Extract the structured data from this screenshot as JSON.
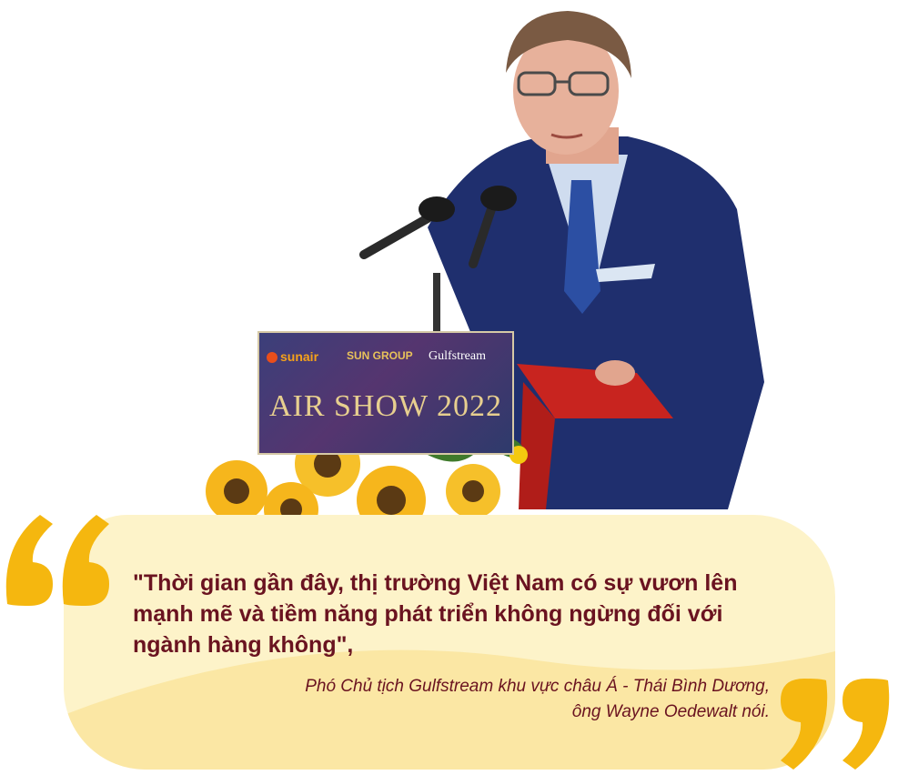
{
  "sign": {
    "logo_sunair": "sunair",
    "logo_sungroup": "SUN GROUP",
    "logo_gulfstream": "Gulfstream",
    "title": "AIR SHOW 2022"
  },
  "quote": {
    "text": "\"Thời gian gần đây, thị trường Việt Nam có sự vươn lên mạnh mẽ và tiềm năng phát triển không ngừng đối với ngành hàng không\",",
    "attribution_line1": "Phó Chủ tịch Gulfstream khu vực châu Á - Thái Bình Dương,",
    "attribution_line2": "ông Wayne Oedewalt nói."
  },
  "colors": {
    "quote_mark": "#f5b70f",
    "card_bg": "#fdf3c9",
    "text": "#6a1320"
  }
}
